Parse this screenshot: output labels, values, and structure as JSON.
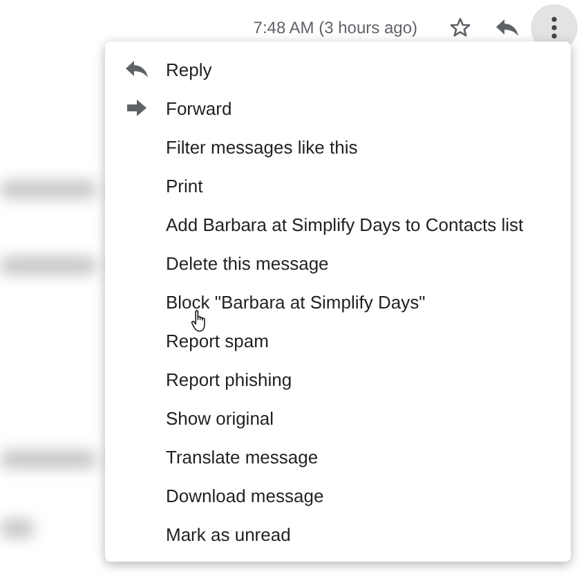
{
  "header": {
    "time": "7:48 AM (3 hours ago)"
  },
  "menu": {
    "items": [
      {
        "kind": "reply",
        "label": "Reply"
      },
      {
        "kind": "forward",
        "label": "Forward"
      },
      {
        "kind": "plain",
        "label": "Filter messages like this"
      },
      {
        "kind": "plain",
        "label": "Print"
      },
      {
        "kind": "plain",
        "label": "Add Barbara at Simplify Days to Contacts list"
      },
      {
        "kind": "plain",
        "label": "Delete this message"
      },
      {
        "kind": "plain",
        "label": "Block \"Barbara at Simplify Days\""
      },
      {
        "kind": "plain",
        "label": "Report spam"
      },
      {
        "kind": "plain",
        "label": "Report phishing"
      },
      {
        "kind": "plain",
        "label": "Show original"
      },
      {
        "kind": "plain",
        "label": "Translate message"
      },
      {
        "kind": "plain",
        "label": "Download message"
      },
      {
        "kind": "plain",
        "label": "Mark as unread"
      }
    ]
  }
}
